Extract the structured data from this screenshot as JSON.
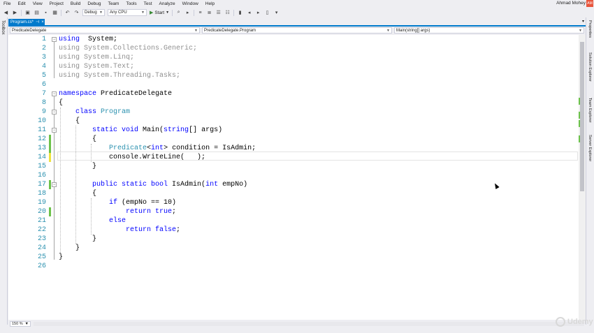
{
  "menu": [
    "File",
    "Edit",
    "View",
    "Project",
    "Build",
    "Debug",
    "Team",
    "Tools",
    "Test",
    "Analyze",
    "Window",
    "Help"
  ],
  "user": {
    "name": "Ahmad Mohey",
    "initials": "AM"
  },
  "toolbar": {
    "config": "Debug",
    "platform": "Any CPU",
    "start_label": "Start"
  },
  "side_tabs": {
    "toolbox": "Toolbox",
    "right": [
      "Properties",
      "Solution Explorer",
      "Team Explorer",
      "Server Explorer"
    ]
  },
  "document_tab": {
    "title": "Program.cs*"
  },
  "navbar": {
    "project": "PredicateDelegate",
    "type": "PredicateDelegate.Program",
    "member": "Main(string[] args)"
  },
  "editor": {
    "lines": [
      {
        "n": "1",
        "t": [
          [
            "kw",
            "using"
          ],
          [
            "",
            "  System;"
          ]
        ]
      },
      {
        "n": "2",
        "t": [
          [
            "dim",
            "using System.Collections.Generic;"
          ]
        ]
      },
      {
        "n": "3",
        "t": [
          [
            "dim",
            "using System.Linq;"
          ]
        ]
      },
      {
        "n": "4",
        "t": [
          [
            "dim",
            "using System.Text;"
          ]
        ]
      },
      {
        "n": "5",
        "t": [
          [
            "dim",
            "using System.Threading.Tasks;"
          ]
        ]
      },
      {
        "n": "6",
        "t": []
      },
      {
        "n": "7",
        "t": [
          [
            "kw",
            "namespace"
          ],
          [
            "",
            " PredicateDelegate"
          ]
        ]
      },
      {
        "n": "8",
        "t": [
          [
            "",
            "{"
          ]
        ]
      },
      {
        "n": "9",
        "t": [
          [
            "",
            "    "
          ],
          [
            "kw",
            "class"
          ],
          [
            "",
            " "
          ],
          [
            "ty",
            "Program"
          ]
        ]
      },
      {
        "n": "10",
        "t": [
          [
            "",
            "    {"
          ]
        ]
      },
      {
        "n": "11",
        "t": [
          [
            "",
            "        "
          ],
          [
            "kw",
            "static void"
          ],
          [
            "",
            " Main("
          ],
          [
            "kw",
            "string"
          ],
          [
            "",
            "[] args)"
          ]
        ]
      },
      {
        "n": "12",
        "t": [
          [
            "",
            "        {"
          ]
        ]
      },
      {
        "n": "13",
        "t": [
          [
            "",
            "            "
          ],
          [
            "ty",
            "Predicate"
          ],
          [
            "",
            "<"
          ],
          [
            "kw",
            "int"
          ],
          [
            "",
            "> condition = IsAdmin;"
          ]
        ]
      },
      {
        "n": "14",
        "t": [
          [
            "",
            "            console.WriteLine(   );"
          ]
        ]
      },
      {
        "n": "15",
        "t": [
          [
            "",
            "        }"
          ]
        ]
      },
      {
        "n": "16",
        "t": []
      },
      {
        "n": "17",
        "t": [
          [
            "",
            "        "
          ],
          [
            "kw",
            "public static bool"
          ],
          [
            "",
            " IsAdmin("
          ],
          [
            "kw",
            "int"
          ],
          [
            "",
            " empNo)"
          ]
        ]
      },
      {
        "n": "18",
        "t": [
          [
            "",
            "        {"
          ]
        ]
      },
      {
        "n": "19",
        "t": [
          [
            "",
            "            "
          ],
          [
            "kw",
            "if"
          ],
          [
            "",
            " (empNo == 10)"
          ]
        ]
      },
      {
        "n": "20",
        "t": [
          [
            "",
            "                "
          ],
          [
            "kw",
            "return true"
          ],
          [
            "",
            ";"
          ]
        ]
      },
      {
        "n": "21",
        "t": [
          [
            "",
            "            "
          ],
          [
            "kw",
            "else"
          ]
        ]
      },
      {
        "n": "22",
        "t": [
          [
            "",
            "                "
          ],
          [
            "kw",
            "return false"
          ],
          [
            "",
            ";"
          ]
        ]
      },
      {
        "n": "23",
        "t": [
          [
            "",
            "        }"
          ]
        ]
      },
      {
        "n": "24",
        "t": [
          [
            "",
            "    }"
          ]
        ]
      },
      {
        "n": "25",
        "t": [
          [
            "",
            "}"
          ]
        ]
      },
      {
        "n": "26",
        "t": []
      }
    ],
    "changes": [
      {
        "line": 12,
        "color": "#6cc24a"
      },
      {
        "line": 13,
        "color": "#6cc24a"
      },
      {
        "line": 14,
        "color": "#efe33f"
      },
      {
        "line": 17,
        "color": "#6cc24a"
      },
      {
        "line": 20,
        "color": "#6cc24a"
      }
    ]
  },
  "zoom": "150 %",
  "watermark": "Udemy"
}
